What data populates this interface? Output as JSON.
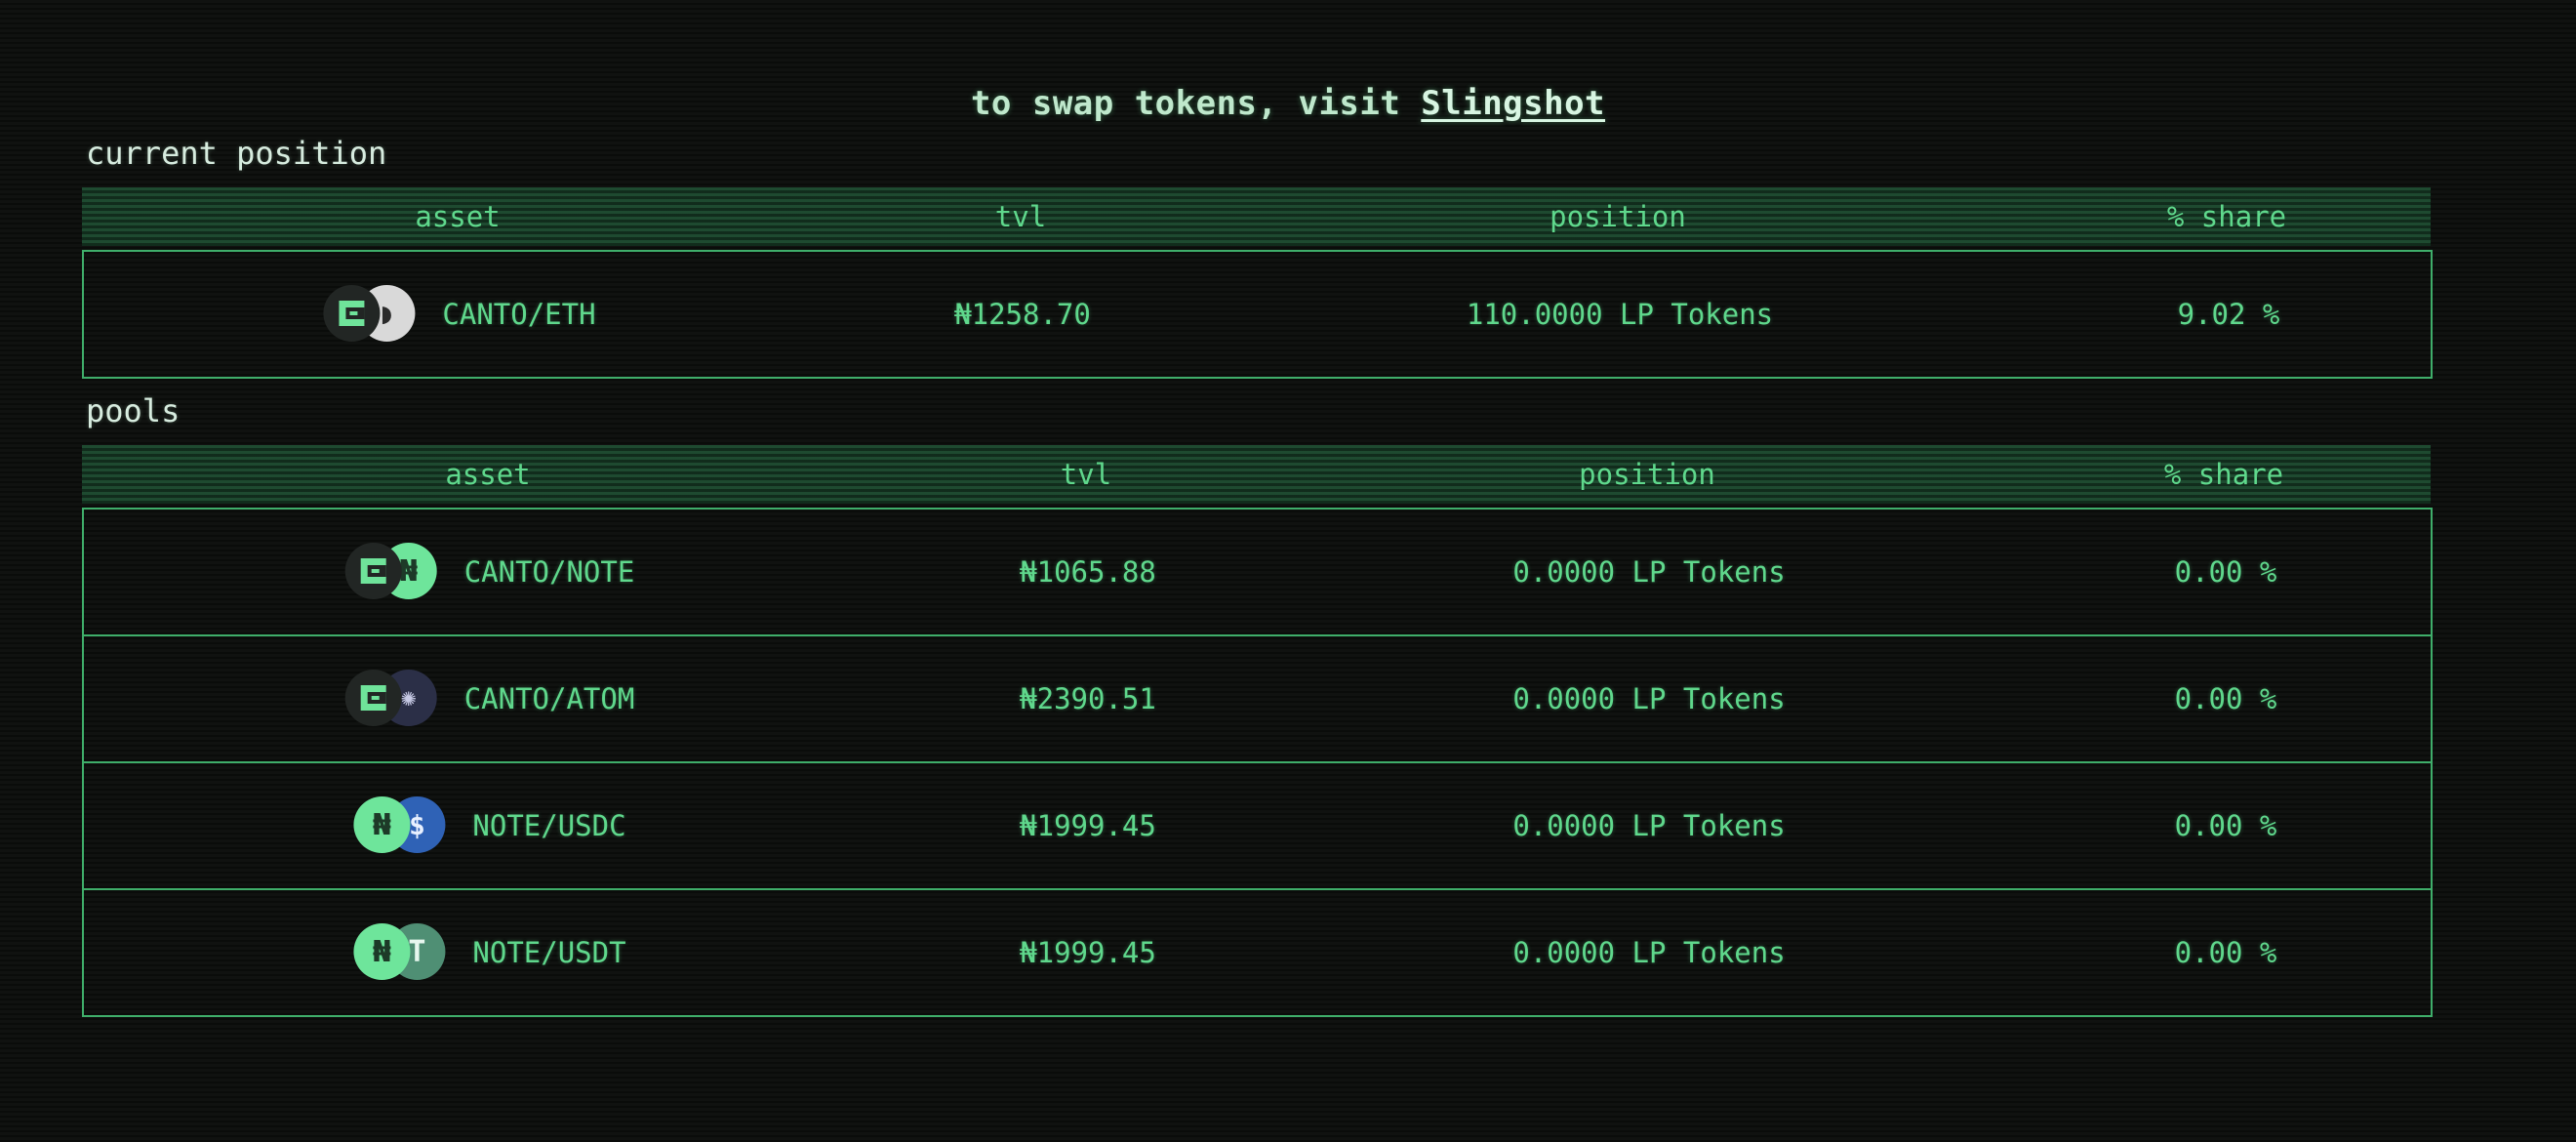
{
  "banner": {
    "prefix": "to swap tokens, visit ",
    "link_label": "Slingshot"
  },
  "current_position": {
    "title": "current position",
    "headers": {
      "asset": "asset",
      "tvl": "tvl",
      "position": "position",
      "share": "% share"
    },
    "rows": [
      {
        "icon1": "canto-icon",
        "icon2": "eth-icon",
        "asset": "CANTO/ETH",
        "tvl": "₦1258.70",
        "position": "110.0000 LP Tokens",
        "share": "9.02 %"
      }
    ]
  },
  "pools": {
    "title": "pools",
    "headers": {
      "asset": "asset",
      "tvl": "tvl",
      "position": "position",
      "share": "% share"
    },
    "rows": [
      {
        "icon1": "canto-icon",
        "icon2": "note-icon",
        "asset": "CANTO/NOTE",
        "tvl": "₦1065.88",
        "position": "0.0000 LP Tokens",
        "share": "0.00 %"
      },
      {
        "icon1": "canto-icon",
        "icon2": "atom-icon",
        "asset": "CANTO/ATOM",
        "tvl": "₦2390.51",
        "position": "0.0000 LP Tokens",
        "share": "0.00 %"
      },
      {
        "icon1": "note-icon",
        "icon2": "usdc-icon",
        "asset": "NOTE/USDC",
        "tvl": "₦1999.45",
        "position": "0.0000 LP Tokens",
        "share": "0.00 %"
      },
      {
        "icon1": "note-icon",
        "icon2": "usdt-icon",
        "asset": "NOTE/USDT",
        "tvl": "₦1999.45",
        "position": "0.0000 LP Tokens",
        "share": "0.00 %"
      }
    ]
  },
  "glyphs": {
    "note": "₦",
    "eth": "◗",
    "atom": "✺",
    "usdc": "$",
    "usdt": "T"
  }
}
